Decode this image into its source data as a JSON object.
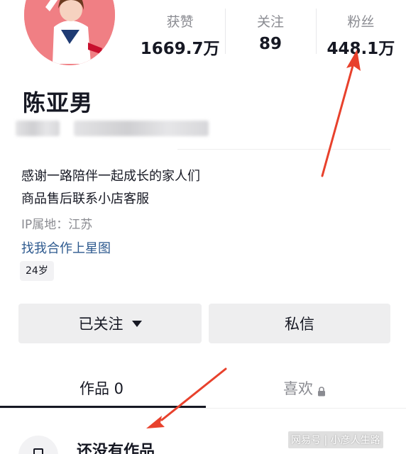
{
  "profile": {
    "name": "陈亚男",
    "bio": [
      "感谢一路陪伴一起成长的家人们",
      "商品售后联系小店客服"
    ],
    "ip_location": "IP属地：江苏",
    "star_link": "找我合作上星图",
    "age_tag": "24岁"
  },
  "stats": [
    {
      "label": "获赞",
      "value": "1669.7万"
    },
    {
      "label": "关注",
      "value": "89"
    },
    {
      "label": "粉丝",
      "value": "448.1万"
    }
  ],
  "actions": {
    "follow_label": "已关注",
    "message_label": "私信"
  },
  "tabs": {
    "works_label": "作品 0",
    "likes_label": "喜欢"
  },
  "empty_state": {
    "title": "还没有作品"
  },
  "watermark": "网易号 | 小彦人生路",
  "colors": {
    "annotation_arrow": "#e8412c",
    "link": "#2e5a8f",
    "avatar_bg": "#f07f84"
  },
  "icons": [
    "caret-down-icon",
    "lock-icon",
    "works-icon"
  ]
}
